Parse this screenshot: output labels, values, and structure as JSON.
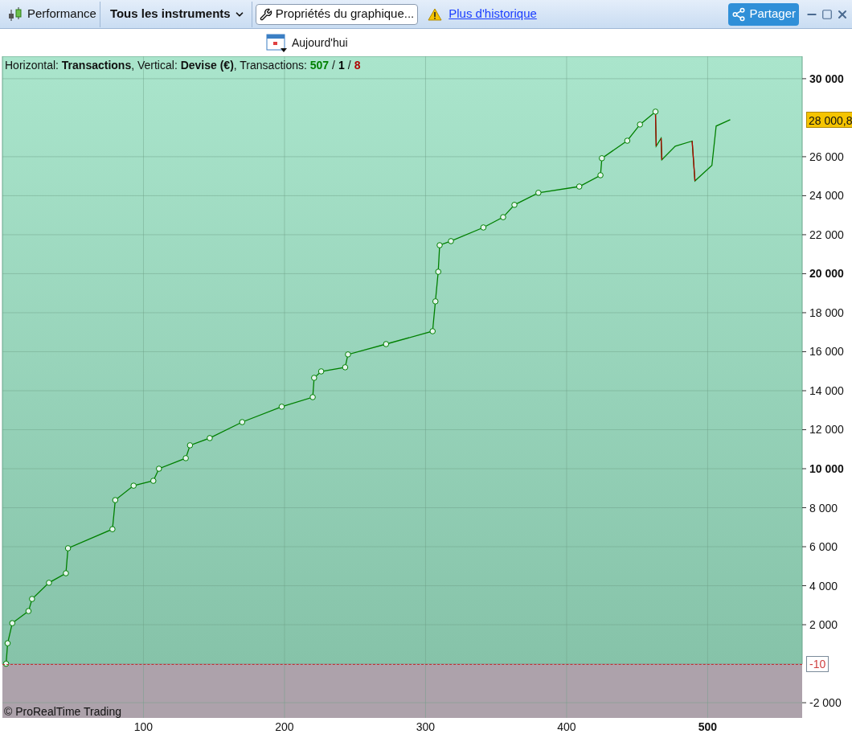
{
  "toolbar": {
    "performance": "Performance",
    "instruments": "Tous les instruments",
    "properties": "Propriétés du graphique...",
    "history_link": "Plus d'historique",
    "share": "Partager"
  },
  "date_button": "Aujourd'hui",
  "info": {
    "separator": "/",
    "text": "Horizontal: **Transactions**, Vertical: **Devise (€)**, Transactions: ",
    "counts": [
      {
        "value": "507",
        "color": "#008000"
      },
      {
        "value": "1",
        "color": "#000000"
      },
      {
        "value": "8",
        "color": "#b00000"
      }
    ]
  },
  "copyright": "© ProRealTime Trading",
  "last_value": "28 000,8",
  "zero_label": "-10",
  "chart_data": {
    "type": "line",
    "grid": true,
    "xlim": [
      0,
      567
    ],
    "ylim": [
      -2780,
      31150
    ],
    "xticks": [
      {
        "value": 100,
        "label": "100"
      },
      {
        "value": 200,
        "label": "200"
      },
      {
        "value": 300,
        "label": "300"
      },
      {
        "value": 400,
        "label": "400"
      },
      {
        "value": 500,
        "label": "500"
      }
    ],
    "yticks": [
      {
        "value": -2000,
        "label": "-2 000"
      },
      {
        "value": 2000,
        "label": "2 000"
      },
      {
        "value": 4000,
        "label": "4 000"
      },
      {
        "value": 6000,
        "label": "6 000"
      },
      {
        "value": 8000,
        "label": "8 000"
      },
      {
        "value": 10000,
        "label": "10 000"
      },
      {
        "value": 12000,
        "label": "12 000"
      },
      {
        "value": 14000,
        "label": "14 000"
      },
      {
        "value": 16000,
        "label": "16 000"
      },
      {
        "value": 18000,
        "label": "18 000"
      },
      {
        "value": 20000,
        "label": "20 000"
      },
      {
        "value": 22000,
        "label": "22 000"
      },
      {
        "value": 24000,
        "label": "24 000"
      },
      {
        "value": 26000,
        "label": "26 000"
      },
      {
        "value": 30000,
        "label": "30 000"
      }
    ],
    "x": [
      2.6,
      3.7,
      7,
      18.5,
      21,
      33,
      45,
      46.5,
      78,
      80,
      93,
      107,
      111,
      130,
      133,
      147,
      170,
      198,
      220,
      221,
      226,
      243,
      245,
      272,
      305,
      307,
      309,
      310,
      318,
      341,
      355,
      363,
      380,
      409,
      424,
      425,
      443,
      452,
      463,
      463.5,
      467,
      467.5,
      477,
      489,
      491,
      503,
      506,
      516
    ],
    "series": [
      {
        "color": "#008000",
        "marker": "circle",
        "values": [
          0,
          1050,
          2080,
          2700,
          3320,
          4150,
          4640,
          5920,
          6900,
          8390,
          9130,
          9380,
          10000,
          10540,
          11200,
          11570,
          12390,
          13180,
          13670,
          14660,
          14990,
          15200,
          15860,
          16390,
          17050,
          18580,
          20100,
          21460,
          21670,
          22370,
          22900,
          23530,
          24150,
          24470,
          25050,
          25920,
          26820,
          27650,
          28310,
          null,
          null,
          null,
          null,
          null,
          null,
          null,
          null,
          null
        ]
      },
      {
        "color": "#008000",
        "values": [
          null,
          null,
          null,
          null,
          null,
          null,
          null,
          null,
          null,
          null,
          null,
          null,
          null,
          null,
          null,
          null,
          null,
          null,
          null,
          null,
          null,
          null,
          null,
          null,
          null,
          null,
          null,
          null,
          null,
          null,
          null,
          null,
          null,
          null,
          null,
          null,
          null,
          null,
          28310,
          26540,
          26950,
          25840,
          26540,
          26800,
          24760,
          25550,
          27570,
          27900
        ]
      }
    ]
  }
}
